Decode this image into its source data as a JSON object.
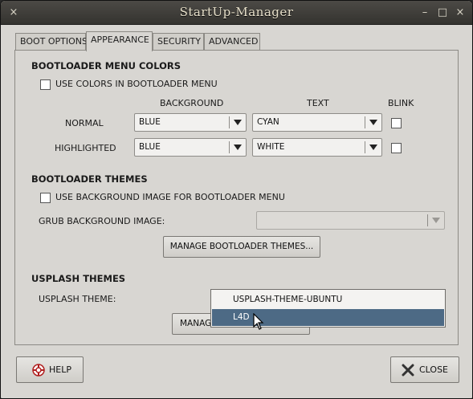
{
  "window": {
    "title": "StartUp-Manager"
  },
  "titlebar_icons": {
    "close": "×",
    "minimize": "–",
    "maximize": "□",
    "close_right": "×"
  },
  "tabs": [
    {
      "label": "BOOT OPTIONS",
      "active": false
    },
    {
      "label": "APPEARANCE",
      "active": true
    },
    {
      "label": "SECURITY",
      "active": false
    },
    {
      "label": "ADVANCED",
      "active": false
    }
  ],
  "menu_colors": {
    "heading": "BOOTLOADER MENU COLORS",
    "use_colors_label": "USE COLORS IN BOOTLOADER MENU",
    "use_colors_checked": false,
    "col_background": "BACKGROUND",
    "col_text": "TEXT",
    "col_blink": "BLINK",
    "rows": [
      {
        "label": "NORMAL",
        "background": "BLUE",
        "text": "CYAN",
        "blink": false
      },
      {
        "label": "HIGHLIGHTED",
        "background": "BLUE",
        "text": "WHITE",
        "blink": false
      }
    ]
  },
  "themes": {
    "heading": "BOOTLOADER THEMES",
    "use_bg_label": "USE BACKGROUND IMAGE FOR BOOTLOADER MENU",
    "use_bg_checked": false,
    "grub_bg_label": "GRUB BACKGROUND IMAGE:",
    "grub_bg_value": "",
    "manage_button": "MANAGE BOOTLOADER THEMES..."
  },
  "usplash": {
    "heading": "USPLASH THEMES",
    "theme_label": "USPLASH THEME:",
    "manage_button_partial": "MANAG",
    "options": [
      "USPLASH-THEME-UBUNTU",
      "L4D"
    ],
    "selected": "L4D"
  },
  "footer": {
    "help": "HELP",
    "close": "CLOSE"
  },
  "colors": {
    "selection": "#4d6a85",
    "titlebar": "#3d3c38",
    "title_text": "#e6dfc9"
  }
}
